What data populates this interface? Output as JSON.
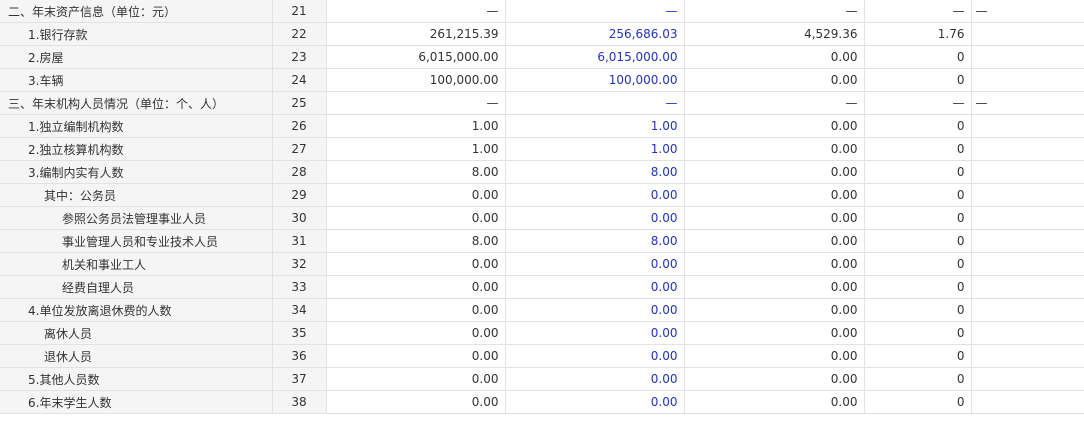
{
  "rows": [
    {
      "name": "二、年末资产信息（单位：元）",
      "indent": 0,
      "idx": "21",
      "c1": "—",
      "c2": "—",
      "c3": "—",
      "c4": "—",
      "c5": "—"
    },
    {
      "name": "1.银行存款",
      "indent": 1,
      "idx": "22",
      "c1": "261,215.39",
      "c2": "256,686.03",
      "c3": "4,529.36",
      "c4": "1.76",
      "c5": ""
    },
    {
      "name": "2.房屋",
      "indent": 1,
      "idx": "23",
      "c1": "6,015,000.00",
      "c2": "6,015,000.00",
      "c3": "0.00",
      "c4": "0",
      "c5": ""
    },
    {
      "name": "3.车辆",
      "indent": 1,
      "idx": "24",
      "c1": "100,000.00",
      "c2": "100,000.00",
      "c3": "0.00",
      "c4": "0",
      "c5": ""
    },
    {
      "name": "三、年末机构人员情况（单位：个、人）",
      "indent": 0,
      "idx": "25",
      "c1": "—",
      "c2": "—",
      "c3": "—",
      "c4": "—",
      "c5": "—"
    },
    {
      "name": "1.独立编制机构数",
      "indent": 1,
      "idx": "26",
      "c1": "1.00",
      "c2": "1.00",
      "c3": "0.00",
      "c4": "0",
      "c5": ""
    },
    {
      "name": "2.独立核算机构数",
      "indent": 1,
      "idx": "27",
      "c1": "1.00",
      "c2": "1.00",
      "c3": "0.00",
      "c4": "0",
      "c5": ""
    },
    {
      "name": "3.编制内实有人数",
      "indent": 1,
      "idx": "28",
      "c1": "8.00",
      "c2": "8.00",
      "c3": "0.00",
      "c4": "0",
      "c5": ""
    },
    {
      "name": "其中：公务员",
      "indent": 2,
      "idx": "29",
      "c1": "0.00",
      "c2": "0.00",
      "c3": "0.00",
      "c4": "0",
      "c5": ""
    },
    {
      "name": "参照公务员法管理事业人员",
      "indent": 3,
      "idx": "30",
      "c1": "0.00",
      "c2": "0.00",
      "c3": "0.00",
      "c4": "0",
      "c5": ""
    },
    {
      "name": "事业管理人员和专业技术人员",
      "indent": 3,
      "idx": "31",
      "c1": "8.00",
      "c2": "8.00",
      "c3": "0.00",
      "c4": "0",
      "c5": ""
    },
    {
      "name": "机关和事业工人",
      "indent": 3,
      "idx": "32",
      "c1": "0.00",
      "c2": "0.00",
      "c3": "0.00",
      "c4": "0",
      "c5": ""
    },
    {
      "name": "经费自理人员",
      "indent": 3,
      "idx": "33",
      "c1": "0.00",
      "c2": "0.00",
      "c3": "0.00",
      "c4": "0",
      "c5": ""
    },
    {
      "name": "4.单位发放离退休费的人数",
      "indent": 1,
      "idx": "34",
      "c1": "0.00",
      "c2": "0.00",
      "c3": "0.00",
      "c4": "0",
      "c5": ""
    },
    {
      "name": "离休人员",
      "indent": 2,
      "idx": "35",
      "c1": "0.00",
      "c2": "0.00",
      "c3": "0.00",
      "c4": "0",
      "c5": ""
    },
    {
      "name": "退休人员",
      "indent": 2,
      "idx": "36",
      "c1": "0.00",
      "c2": "0.00",
      "c3": "0.00",
      "c4": "0",
      "c5": ""
    },
    {
      "name": "5.其他人员数",
      "indent": 1,
      "idx": "37",
      "c1": "0.00",
      "c2": "0.00",
      "c3": "0.00",
      "c4": "0",
      "c5": ""
    },
    {
      "name": "6.年末学生人数",
      "indent": 1,
      "idx": "38",
      "c1": "0.00",
      "c2": "0.00",
      "c3": "0.00",
      "c4": "0",
      "c5": ""
    }
  ],
  "colors": {
    "blue_value": "#2233bb",
    "label_bg": "#f5f5f5",
    "grid": "#e2e2e2"
  }
}
